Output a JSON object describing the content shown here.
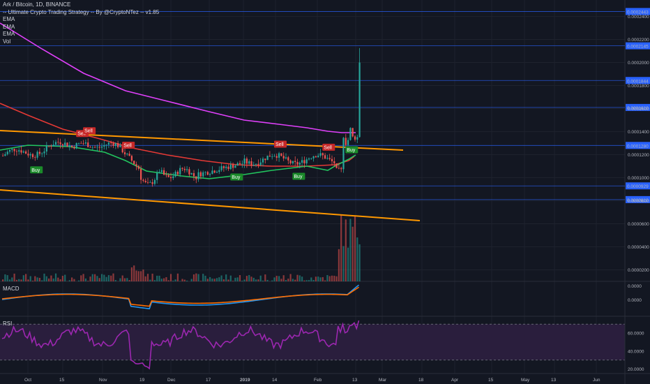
{
  "header": {
    "title": "Ark / Bitcoin, 1D, BINANCE",
    "strategy": "-- Ultimate Crypto Trading Strategy -- By @CryptoNTez -- v1.85",
    "indicators": [
      "EMA",
      "EMA",
      "EMA",
      "Vol"
    ]
  },
  "panes": {
    "macd_title": "MACD",
    "rsi_title": "RSI"
  },
  "colors": {
    "background": "#131722",
    "up": "#26a69a",
    "down": "#ef5350",
    "ema_fast": "#22c55e",
    "ema_mid": "#e53935",
    "ema_slow": "#e040fb",
    "trendline": "#ff9800",
    "hline": "#2962ff",
    "macd": "#2196f3",
    "signal": "#ff6d00",
    "rsi": "#9c27b0",
    "rsi_band": "#2a1e3d",
    "buy": "#1b8a2a",
    "sell": "#c62828"
  },
  "chart_data": {
    "type": "candlestick",
    "title": "Ark / Bitcoin, 1D, BINANCE",
    "x_ticks": [
      "Oct",
      "15",
      "Nov",
      "19",
      "Dec",
      "17",
      "2019",
      "14",
      "Feb",
      "13",
      "Mar",
      "18",
      "Apr",
      "15",
      "May",
      "13",
      "Jun"
    ],
    "price_axis_ticks": [
      "0.0002400",
      "0.0002200",
      "0.0002000",
      "0.0001800",
      "0.0001600",
      "0.0001400",
      "0.0001200",
      "0.0001000",
      "0.0000800",
      "0.0000600",
      "0.0000400",
      "0.0000200"
    ],
    "price_ylim": [
      1e-05,
      0.000247
    ],
    "horizontal_levels": [
      "0.0002443",
      "0.0002145",
      "0.0001844",
      "0.0001610",
      "0.0001280",
      "0.0000929",
      "0.0000810"
    ],
    "macd_axis_ticks": [
      "0.0000",
      "0.0000"
    ],
    "rsi_axis_ticks": [
      "60.0000",
      "40.0000",
      "20.0000"
    ],
    "rsi_band": [
      30,
      70
    ],
    "rsi_ylim": [
      15,
      78
    ],
    "signals": [
      {
        "label": "Sell",
        "bar": 34,
        "side": "sell"
      },
      {
        "label": "Buy",
        "bar": 14,
        "side": "buy"
      },
      {
        "label": "Sell",
        "bar": 37,
        "side": "sell"
      },
      {
        "label": "Sell",
        "bar": 54,
        "side": "sell"
      },
      {
        "label": "Buy",
        "bar": 101,
        "side": "buy"
      },
      {
        "label": "Sell",
        "bar": 120,
        "side": "sell"
      },
      {
        "label": "Buy",
        "bar": 128,
        "side": "buy"
      },
      {
        "label": "Sell",
        "bar": 141,
        "side": "sell"
      },
      {
        "label": "Buy",
        "bar": 151,
        "side": "buy"
      }
    ],
    "candles": {
      "description_free": true,
      "seed": 7
    }
  }
}
